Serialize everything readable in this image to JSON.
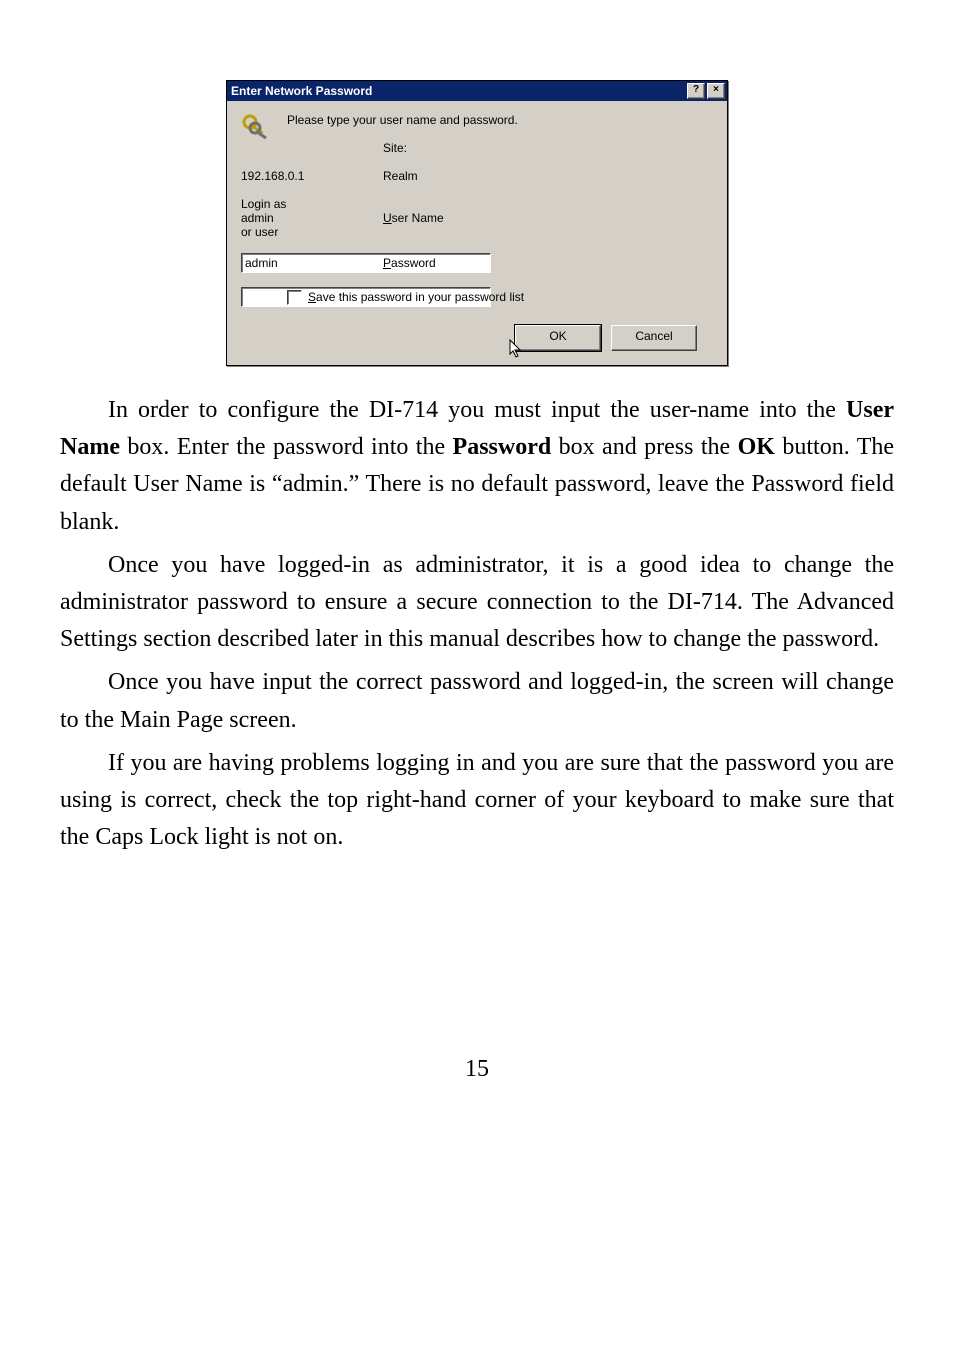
{
  "dialog": {
    "title": "Enter Network Password",
    "help_btn": "?",
    "close_btn": "×",
    "prompt": "Please type your user name and password.",
    "site_label": "Site:",
    "site_value": "192.168.0.1",
    "realm_label": "Realm",
    "realm_value": "Login as admin or user",
    "user_label_pre": "U",
    "user_label_post": "ser Name",
    "user_value": "admin",
    "pass_label_pre": "P",
    "pass_label_post": "assword",
    "pass_value": "",
    "save_label_pre": "S",
    "save_label_post": "ave this password in your password list",
    "ok_label": "OK",
    "cancel_label": "Cancel"
  },
  "doc": {
    "p1_a": "In order to configure the DI-714 you must input the user-name into the ",
    "p1_b": "User Name",
    "p1_c": " box.  Enter the password into the ",
    "p1_d": "Password",
    "p1_e": " box and press the ",
    "p1_f": "OK",
    "p1_g": " button.   The default User Name is “admin.”   There is no default password, leave the Password field blank.",
    "p2": "Once you have logged-in as administrator, it is a good idea to change the administrator password to ensure a secure connection to the DI-714. The Advanced Settings section described later in this manual describes how to change the password.",
    "p3": "Once you have input the correct password and logged-in, the screen will change to the Main Page screen.",
    "p4": "If you are having problems logging in and you are sure that the password you are using is correct, check the top right-hand corner of your keyboard to make sure that the Caps Lock light is not on.",
    "page_number": "15"
  }
}
